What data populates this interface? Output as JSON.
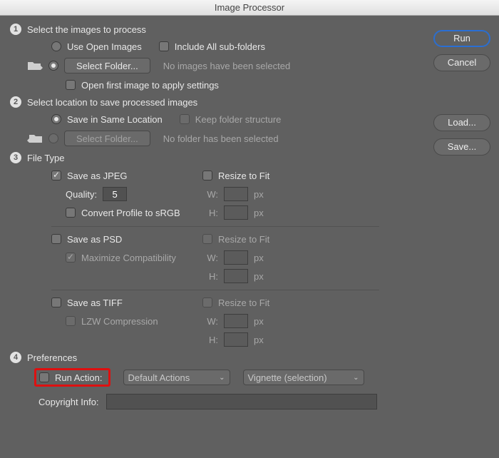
{
  "title": "Image Processor",
  "buttons": {
    "run": "Run",
    "cancel": "Cancel",
    "load": "Load...",
    "save": "Save..."
  },
  "section1": {
    "heading": "Select the images to process",
    "use_open": "Use Open Images",
    "include_sub": "Include All sub-folders",
    "select_folder": "Select Folder...",
    "no_images": "No images have been selected",
    "open_first": "Open first image to apply settings"
  },
  "section2": {
    "heading": "Select location to save processed images",
    "same_loc": "Save in Same Location",
    "keep_struct": "Keep folder structure",
    "select_folder": "Select Folder...",
    "no_folder": "No folder has been selected"
  },
  "section3": {
    "heading": "File Type",
    "jpeg": {
      "label": "Save as JPEG",
      "quality_label": "Quality:",
      "quality_value": "5",
      "convert_srgb": "Convert Profile to sRGB",
      "resize": "Resize to Fit",
      "w": "W:",
      "h": "H:",
      "px": "px"
    },
    "psd": {
      "label": "Save as PSD",
      "max_compat": "Maximize Compatibility",
      "resize": "Resize to Fit",
      "w": "W:",
      "h": "H:",
      "px": "px"
    },
    "tiff": {
      "label": "Save as TIFF",
      "lzw": "LZW Compression",
      "resize": "Resize to Fit",
      "w": "W:",
      "h": "H:",
      "px": "px"
    }
  },
  "section4": {
    "heading": "Preferences",
    "run_action": "Run Action:",
    "action_set": "Default Actions",
    "action": "Vignette (selection)",
    "copyright_label": "Copyright Info:"
  }
}
